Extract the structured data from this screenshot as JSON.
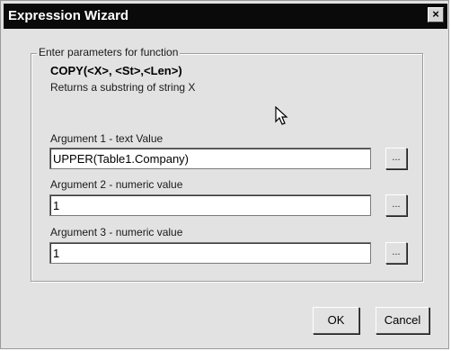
{
  "window": {
    "title": "Expression Wizard",
    "close_icon": "×"
  },
  "group": {
    "label": "Enter parameters for function",
    "function_signature": "COPY(<X>, <St>,<Len>)",
    "description": "Returns a substring of string X"
  },
  "arguments": [
    {
      "label": "Argument 1 - text Value",
      "value": "UPPER(Table1.Company)",
      "browse_label": "..."
    },
    {
      "label": "Argument 2 - numeric value",
      "value": "1",
      "browse_label": "..."
    },
    {
      "label": "Argument 3 - numeric value",
      "value": "1",
      "browse_label": "..."
    }
  ],
  "buttons": {
    "ok": "OK",
    "cancel": "Cancel"
  }
}
